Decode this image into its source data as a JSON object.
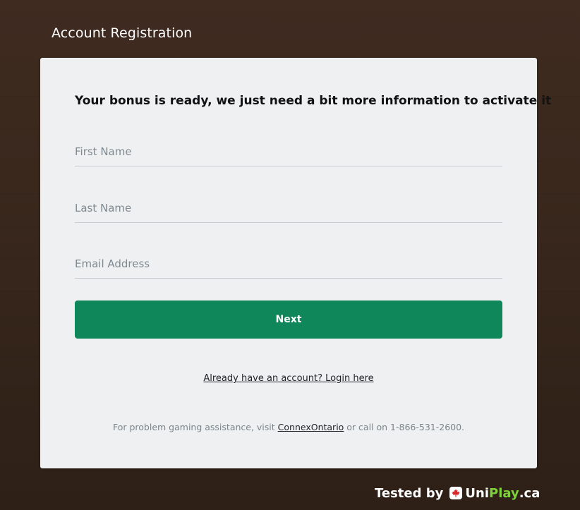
{
  "page": {
    "title": "Account Registration"
  },
  "form": {
    "headline": "Your bonus is ready, we just need a bit more information to activate it",
    "first_name_placeholder": "First Name",
    "last_name_placeholder": "Last Name",
    "email_placeholder": "Email Address",
    "first_name_value": "",
    "last_name_value": "",
    "email_value": "",
    "next_label": "Next",
    "login_text": "Already have an account? Login here",
    "help_prefix": "For problem gaming assistance, visit ",
    "help_link": "ConnexOntario",
    "help_suffix": " or call on 1-866-531-2600."
  },
  "badge": {
    "tested_by": "Tested by",
    "brand_uni": "Uni",
    "brand_play": "Play",
    "brand_tld": ".ca",
    "flag_icon": "maple-leaf-icon"
  },
  "colors": {
    "button": "#10875a",
    "background": "#3a281d",
    "card": "#eef0f2",
    "brand_green": "#7ed23b"
  }
}
